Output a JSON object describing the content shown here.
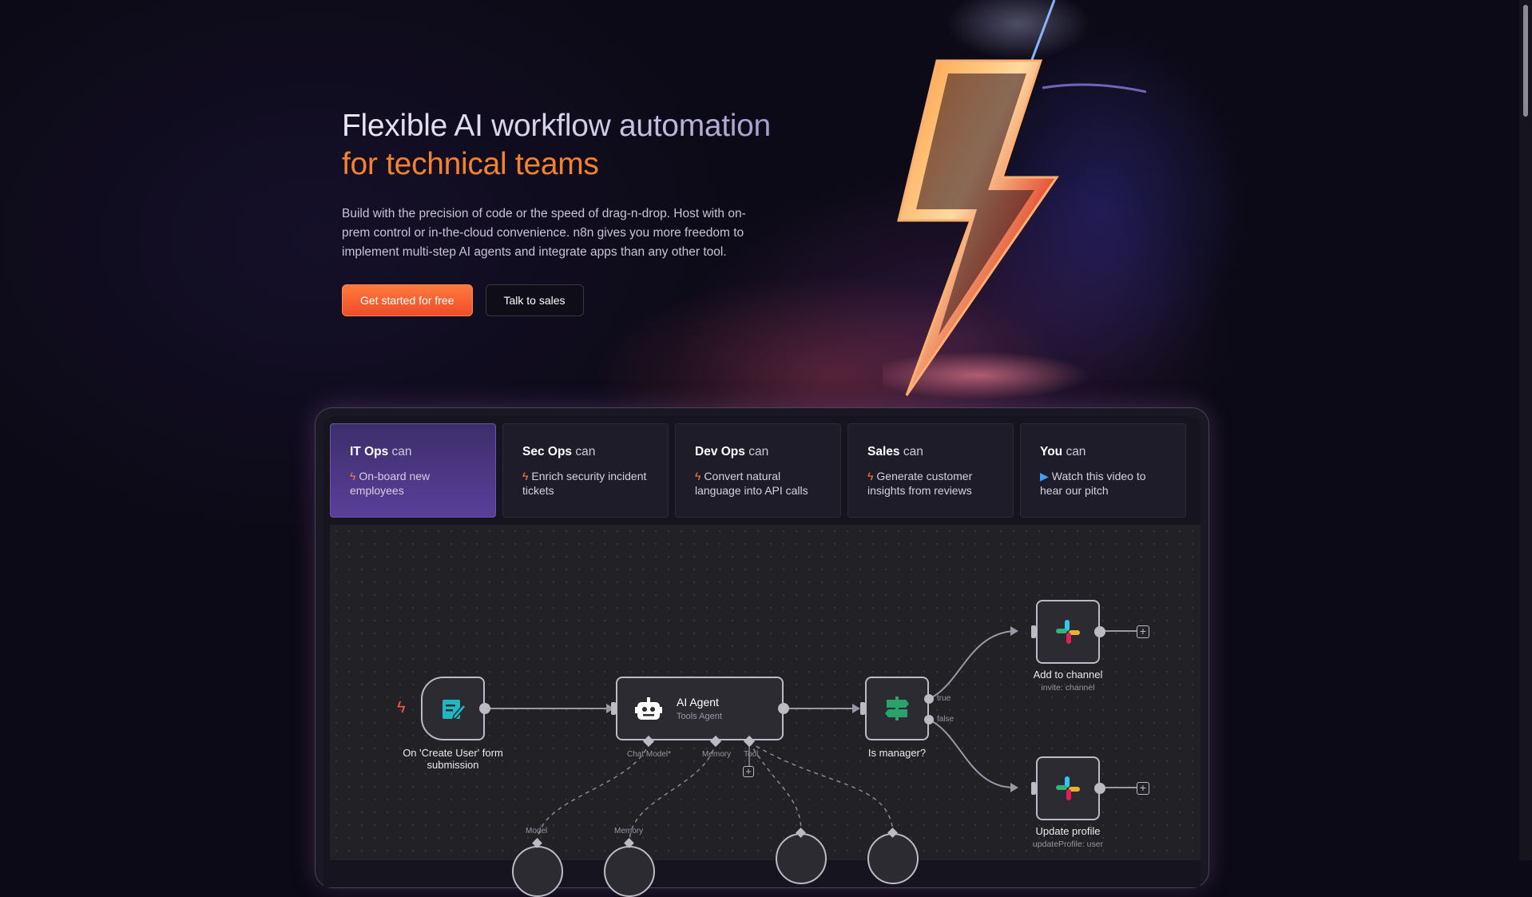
{
  "hero": {
    "title_part1": "Flexible AI workflow automation",
    "title_part2": "for technical teams",
    "description": "Build with the precision of code or the speed of drag-n-drop. Host with on-prem control or in-the-cloud convenience. n8n gives you more freedom to implement multi-step AI agents and integrate apps than any other tool.",
    "cta_primary": "Get started for free",
    "cta_secondary": "Talk to sales"
  },
  "tabs": [
    {
      "team": "IT Ops",
      "can": "can",
      "action": "On-board new employees",
      "icon": "bolt-icon",
      "active": true
    },
    {
      "team": "Sec Ops",
      "can": "can",
      "action": "Enrich security incident tickets",
      "icon": "bolt-icon",
      "active": false
    },
    {
      "team": "Dev Ops",
      "can": "can",
      "action": "Convert natural language into API calls",
      "icon": "bolt-icon",
      "active": false
    },
    {
      "team": "Sales",
      "can": "can",
      "action": "Generate customer insights from reviews",
      "icon": "bolt-icon",
      "active": false
    },
    {
      "team": "You",
      "can": "can",
      "action": "Watch this video to hear our pitch",
      "icon": "play-icon",
      "active": false
    }
  ],
  "workflow": {
    "trigger": {
      "label": "On 'Create User' form submission"
    },
    "agent": {
      "title": "AI Agent",
      "subtitle": "Tools Agent",
      "ports": [
        "Chat Model*",
        "Memory",
        "Tool"
      ]
    },
    "condition": {
      "label": "Is manager?",
      "branches": [
        "true",
        "false"
      ]
    },
    "slack_channel": {
      "label": "Add to channel",
      "sub": "invite: channel"
    },
    "slack_profile": {
      "label": "Update profile",
      "sub": "updateProfile: user"
    },
    "sub_nodes": [
      "Model",
      "Memory"
    ]
  },
  "colors": {
    "accent_orange": "#f5822e",
    "active_tab": "#5a3f9a",
    "node_green": "#2aa26b",
    "node_teal": "#20b6c2"
  }
}
